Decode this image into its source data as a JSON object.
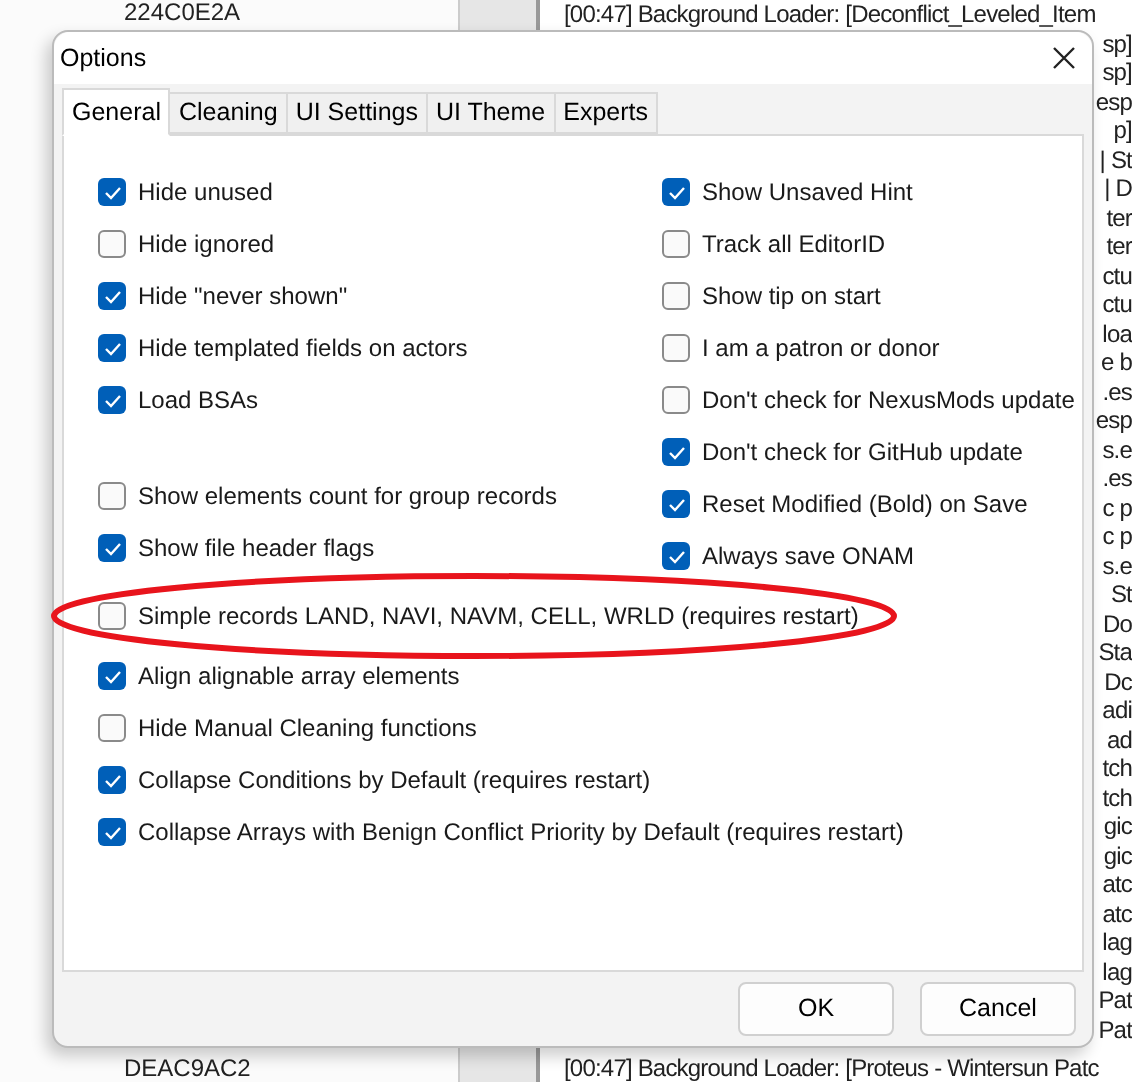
{
  "background": {
    "left_list": {
      "top_value": "224C0E2A",
      "bottom_value": "DEAC9AC2"
    },
    "log": {
      "top_lines": [
        "[00:47] Background Loader: [Deconflict_Leveled_Item"
      ],
      "fragments": [
        "sp]",
        "sp]",
        "esp",
        "p]",
        "| St",
        "| D",
        "ter",
        "ter",
        "ctu",
        "ctu",
        "loa",
        "e b",
        ".es",
        "esp",
        "s.e",
        ".es",
        "c p",
        "c p",
        "s.e",
        "St",
        "Do",
        "Sta",
        "Dc",
        "adi",
        "ad",
        "tch",
        "tch",
        "gic",
        "gic",
        "atc",
        "atc",
        "lag",
        "lag",
        "Pat",
        "Pat"
      ],
      "bottom_line": "[00:47] Background Loader: [Proteus - Wintersun Patc"
    }
  },
  "dialog": {
    "title": "Options",
    "tabs": [
      {
        "label": "General",
        "selected": true
      },
      {
        "label": "Cleaning",
        "selected": false
      },
      {
        "label": "UI Settings",
        "selected": false
      },
      {
        "label": "UI Theme",
        "selected": false
      },
      {
        "label": "Experts",
        "selected": false
      }
    ],
    "left_column": [
      [
        {
          "label": "Hide unused",
          "checked": true
        },
        {
          "label": "Hide ignored",
          "checked": false
        },
        {
          "label": "Hide \"never shown\"",
          "checked": true
        },
        {
          "label": "Hide templated fields on actors",
          "checked": true
        },
        {
          "label": "Load BSAs",
          "checked": true
        }
      ],
      [
        {
          "label": "Show elements count for group records",
          "checked": false
        },
        {
          "label": "Show file header flags",
          "checked": true
        }
      ]
    ],
    "right_column": [
      {
        "label": "Show Unsaved Hint",
        "checked": true
      },
      {
        "label": "Track all EditorID",
        "checked": false
      },
      {
        "label": "Show tip on start",
        "checked": false
      },
      {
        "label": "I am a patron or donor",
        "checked": false
      },
      {
        "label": "Don't check for NexusMods update",
        "checked": false
      },
      {
        "label": "Don't check for GitHub update",
        "checked": true
      },
      {
        "label": "Reset Modified (Bold) on Save",
        "checked": true
      },
      {
        "label": "Always save ONAM",
        "checked": true
      }
    ],
    "wide_options": [
      {
        "label": "Simple records LAND, NAVI, NAVM, CELL, WRLD (requires restart)",
        "checked": false,
        "highlighted": true
      },
      {
        "label": "Align alignable array elements",
        "checked": true,
        "highlighted": false
      },
      {
        "label": "Hide Manual Cleaning functions",
        "checked": false,
        "highlighted": false
      },
      {
        "label": "Collapse Conditions by Default (requires restart)",
        "checked": true,
        "highlighted": false
      },
      {
        "label": "Collapse Arrays with Benign Conflict Priority by Default (requires restart)",
        "checked": true,
        "highlighted": false
      }
    ],
    "buttons": [
      "OK",
      "Cancel"
    ]
  }
}
